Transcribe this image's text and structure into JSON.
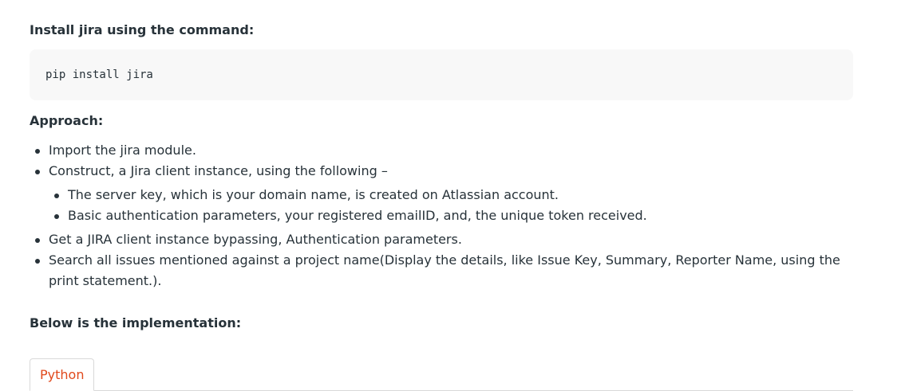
{
  "install_heading": "Install jira using the command:",
  "install_command": "pip install jira",
  "approach_heading": "Approach:",
  "approach_items": [
    "Import the jira module.",
    "Construct, a Jira client instance, using the following –",
    "Get a JIRA client instance bypassing, Authentication parameters.",
    "Search all issues mentioned against a project name(Display the details, like Issue Key, Summary, Reporter Name, using the print statement.)."
  ],
  "approach_sub_items": [
    "The server key, which is your domain name, is created on Atlassian account.",
    "Basic authentication parameters, your registered emailID, and, the unique token received."
  ],
  "implementation_heading": "Below is the implementation:",
  "tabs": [
    {
      "label": "Python",
      "active": true
    }
  ],
  "colors": {
    "text": "#273239",
    "code_background": "#f8f8f8",
    "tab_active": "#e0491c",
    "tab_border": "#d9d9d9"
  }
}
